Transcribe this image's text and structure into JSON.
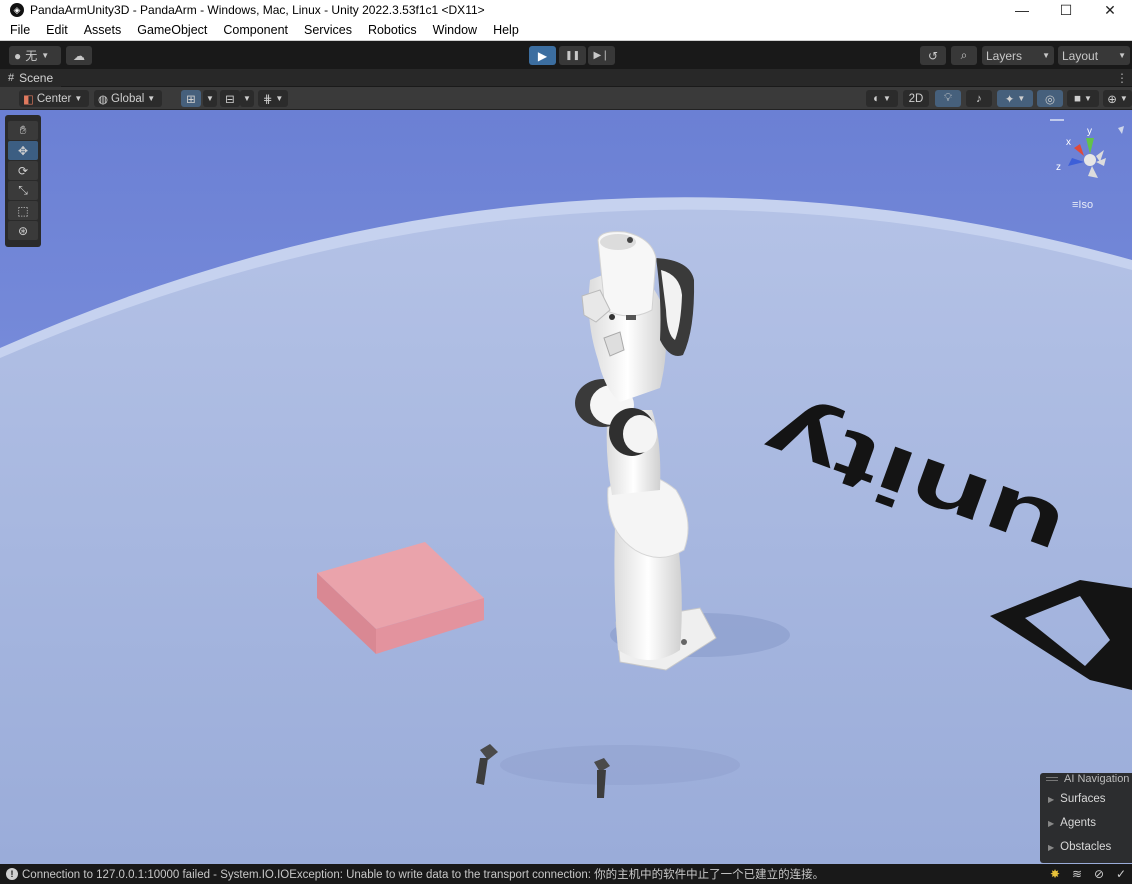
{
  "window": {
    "title": "PandaArmUnity3D - PandaArm - Windows, Mac, Linux - Unity 2022.3.53f1c1 <DX11>",
    "app_icon": "unity-icon",
    "controls": {
      "minimize": "—",
      "maximize": "☐",
      "close": "✕"
    }
  },
  "menu": {
    "items": [
      "File",
      "Edit",
      "Assets",
      "GameObject",
      "Component",
      "Services",
      "Robotics",
      "Window",
      "Help"
    ]
  },
  "toolbar": {
    "account_label": "无",
    "play_icon": "▶",
    "pause_icon": "❚❚",
    "step_icon": "▶❘",
    "history_icon": "↺",
    "search_icon": "⌕",
    "layers_label": "Layers",
    "layout_label": "Layout"
  },
  "scene": {
    "tab_label": "Scene",
    "pivot_label": "Center",
    "space_label": "Global",
    "mode_2d_label": "2D",
    "iso_label": "Iso",
    "gizmo_axes": {
      "x": "x",
      "y": "y",
      "z": "z"
    },
    "ground_logo_text": "unity",
    "colors": {
      "sky": "#6f86d6",
      "ground": "#a3b4de",
      "target_box": "#e69ca4",
      "robot": "#f4f4f4",
      "robot_dark": "#3a3a3a"
    }
  },
  "tools": [
    "hand-tool",
    "move-tool",
    "rotate-tool",
    "scale-tool",
    "rect-tool",
    "transform-tool"
  ],
  "ai_navigation": {
    "title": "AI Navigation",
    "items": [
      "Surfaces",
      "Agents",
      "Obstacles"
    ]
  },
  "status": {
    "message": "Connection to 127.0.0.1:10000 failed - System.IO.IOException: Unable to write data to the transport connection: 你的主机中的软件中止了一个已建立的连接。"
  }
}
